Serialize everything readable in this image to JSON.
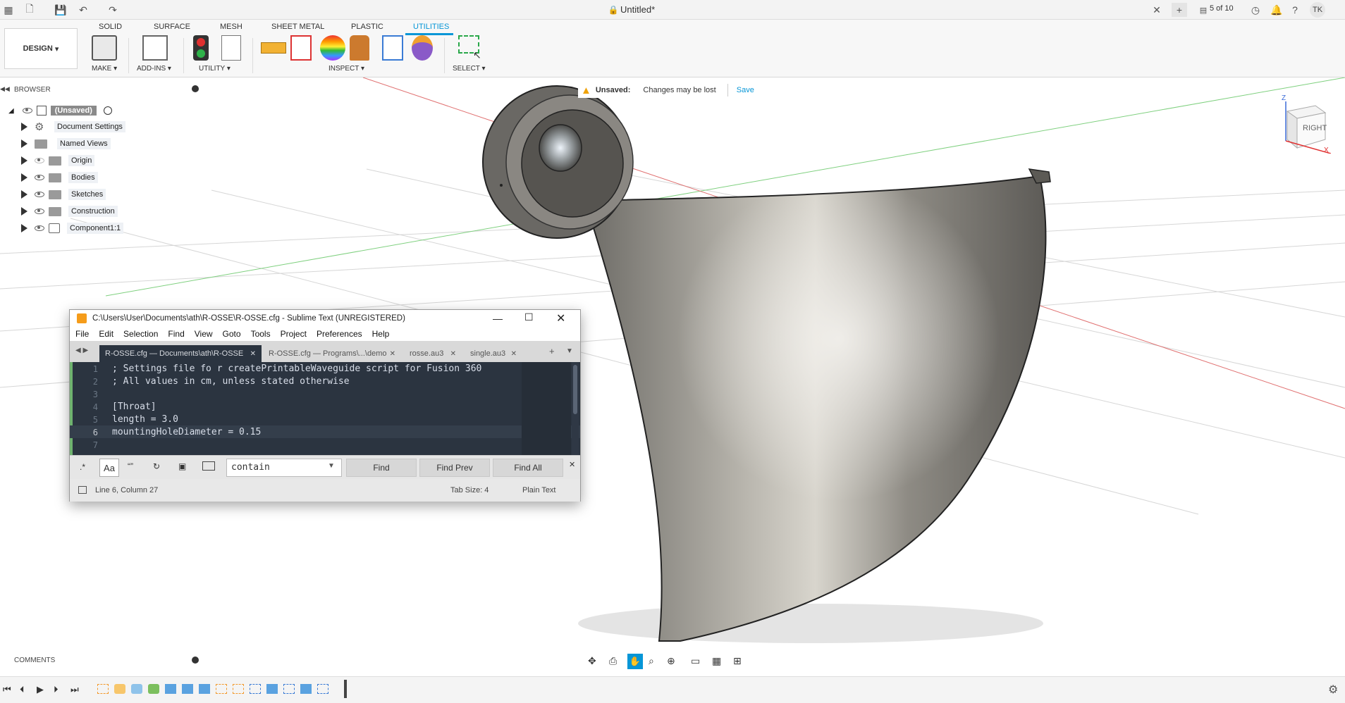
{
  "title_bar": {
    "doc_title": "Untitled*",
    "job_status": "5 of 10",
    "user_initials": "TK"
  },
  "ribbon": {
    "tabs": [
      "SOLID",
      "SURFACE",
      "MESH",
      "SHEET METAL",
      "PLASTIC",
      "UTILITIES"
    ],
    "active_tab": "UTILITIES",
    "workspace": "DESIGN",
    "groups": {
      "make": "MAKE",
      "addins": "ADD-INS",
      "utility": "UTILITY",
      "inspect": "INSPECT",
      "select": "SELECT"
    }
  },
  "browser": {
    "header": "BROWSER",
    "root": "(Unsaved)",
    "items": [
      {
        "label": "Document Settings",
        "icon": "gear-icon"
      },
      {
        "label": "Named Views",
        "icon": "folder-icon"
      },
      {
        "label": "Origin",
        "icon": "folder-icon"
      },
      {
        "label": "Bodies",
        "icon": "folder-icon"
      },
      {
        "label": "Sketches",
        "icon": "folder-icon"
      },
      {
        "label": "Construction",
        "icon": "folder-icon"
      },
      {
        "label": "Component1:1",
        "icon": "component-icon"
      }
    ]
  },
  "unsaved": {
    "label": "Unsaved:",
    "message": "Changes may be lost",
    "save": "Save"
  },
  "viewcube": {
    "face": "RIGHT",
    "axis_z": "Z",
    "axis_x": "X"
  },
  "sublime": {
    "title": "C:\\Users\\User\\Documents\\ath\\R-OSSE\\R-OSSE.cfg - Sublime Text (UNREGISTERED)",
    "menu": [
      "File",
      "Edit",
      "Selection",
      "Find",
      "View",
      "Goto",
      "Tools",
      "Project",
      "Preferences",
      "Help"
    ],
    "tabs": [
      "R-OSSE.cfg — Documents\\ath\\R-OSSE",
      "R-OSSE.cfg — Programs\\...\\demo",
      "rosse.au3",
      "single.au3"
    ],
    "lines": [
      {
        "n": "1",
        "text": "; Settings file fo r createPrintableWaveguide script for Fusion 360"
      },
      {
        "n": "2",
        "text": "; All values in cm, unless stated otherwise"
      },
      {
        "n": "3",
        "text": ""
      },
      {
        "n": "4",
        "text": "[Throat]"
      },
      {
        "n": "5",
        "text": "length = 3.0"
      },
      {
        "n": "6",
        "text": "mountingHoleDiameter = 0.15"
      },
      {
        "n": "7",
        "text": ""
      }
    ],
    "find": {
      "regex": ".*",
      "case": "Aa",
      "word": "“”",
      "query": "contain",
      "find": "Find",
      "find_prev": "Find Prev",
      "find_all": "Find All"
    },
    "status": {
      "position": "Line 6, Column 27",
      "tab_size": "Tab Size: 4",
      "syntax": "Plain Text"
    }
  },
  "comments": {
    "label": "COMMENTS"
  },
  "colors": {
    "accent": "#0696d7",
    "editor_bg": "#2b3440",
    "warning": "#f0a30a"
  }
}
